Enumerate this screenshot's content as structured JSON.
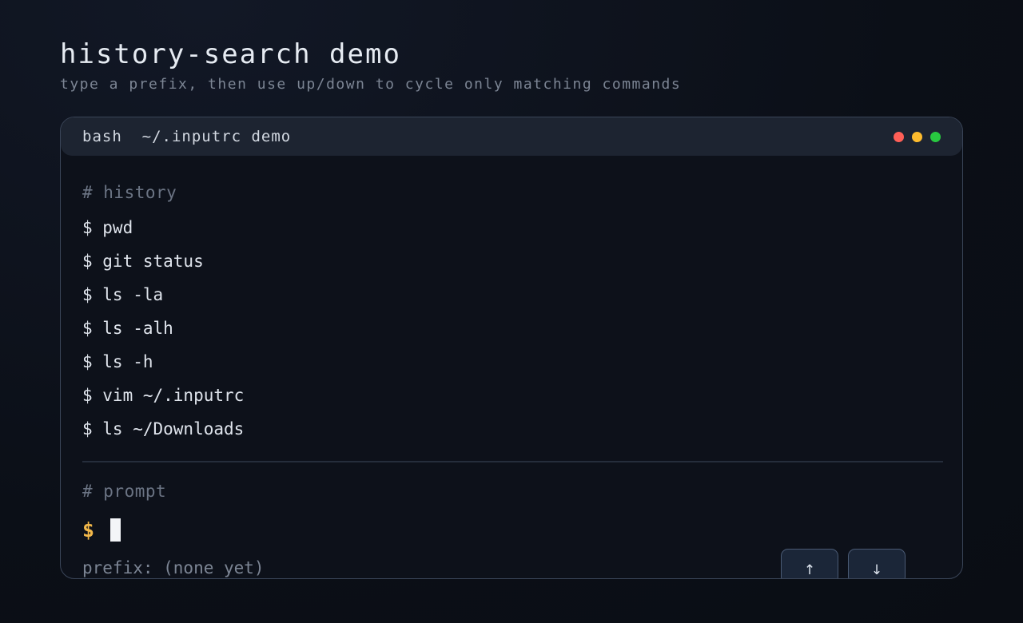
{
  "header": {
    "title": "history-search demo",
    "subtitle": "type a prefix, then use up/down to cycle only matching commands"
  },
  "terminal": {
    "titlebar_text": "bash  ~/.inputrc demo",
    "history_label": "# history",
    "history": [
      "$ pwd",
      "$ git status",
      "$ ls -la",
      "$ ls -alh",
      "$ ls -h",
      "$ vim ~/.inputrc",
      "$ ls ~/Downloads"
    ],
    "prompt_label": "# prompt",
    "prompt_symbol": "$",
    "input_value": "",
    "prefix_status": "prefix: (none yet)",
    "up_button_label": "↑",
    "down_button_label": "↓"
  },
  "colors": {
    "close": "#ff5f57",
    "minimize": "#febc2e",
    "maximize": "#28c840",
    "prompt_accent": "#f2b84a"
  }
}
